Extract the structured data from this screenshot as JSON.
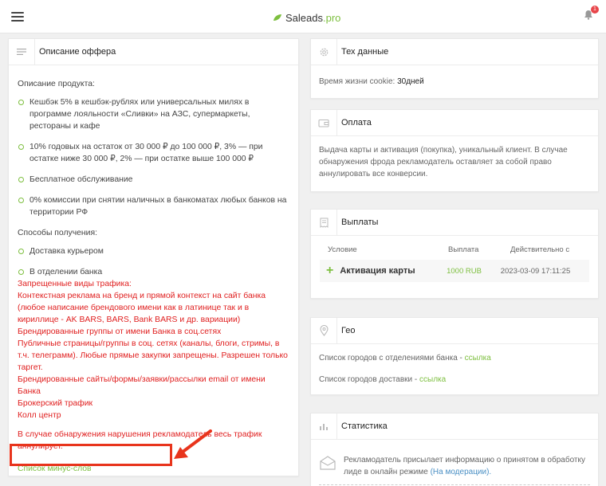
{
  "header": {
    "logo_main": "Saleads",
    "logo_suffix": ".pro",
    "notification_count": "1"
  },
  "offer": {
    "title": "Описание оффера",
    "product_heading": "Описание продукта:",
    "product_items": [
      "Кешбэк 5% в кешбэк-рублях или универсальных милях в программе лояльности «Сливки» на АЗС, супермаркеты, рестораны и кафе",
      "10% годовых на остаток от 30 000 ₽ до 100 000 ₽, 3% — при остатке ниже 30 000 ₽, 2% — при остатке выше 100 000 ₽",
      "Бесплатное обслуживание",
      "0% комиссии при снятии наличных в банкоматах любых банков на территории РФ"
    ],
    "receive_heading": "Способы получения:",
    "receive_items": [
      "Доставка курьером",
      "В отделении банка"
    ],
    "forbidden_lines": [
      "Запрещенные виды трафика:",
      "Контекстная реклама на бренд и прямой контекст на сайт банка (любое написание брендового имени как в латинице так и в кириллице - AK BARS, BARS, Bank BARS и др. вариации)",
      "Брендированные группы от имени Банка в соц.сетях",
      "Публичные страницы/группы в соц. сетях (каналы, блоги, стримы, в т.ч. телеграмм). Любые прямые закупки запрещены. Разрешен только таргет.",
      "Брендированные сайты/формы/заявки/рассылки email от имени Банка",
      "Брокерский трафик",
      "Колл центр"
    ],
    "violation_text": "В случае обнаружения нарушения рекламодатель весь трафик аннулирует.",
    "minus_words_link": "Список минус-слов"
  },
  "tech": {
    "title": "Тех данные",
    "cookie_label": "Время жизни cookie:",
    "cookie_value": "30дней"
  },
  "payment": {
    "title": "Оплата",
    "text": "Выдача карты и активация (покупка), уникальный клиент. В случае обнаружения фрода рекламодатель оставляет за собой право аннулировать все конверсии."
  },
  "payouts": {
    "title": "Выплаты",
    "columns": [
      "Условие",
      "Выплата",
      "Действительно с"
    ],
    "rows": [
      {
        "plus": "+",
        "condition": "Активация карты",
        "payout": "1000 RUB",
        "valid_from": "2023-03-09 17:11:25"
      }
    ]
  },
  "geo": {
    "title": "Гео",
    "line1_text": "Список городов с отделениями банка -",
    "line1_link": "ссылка",
    "line2_text": "Список городов доставки -",
    "line2_link": "ссылка"
  },
  "stats": {
    "title": "Статистика",
    "text": "Рекламодатель присылает информацию о принятом в обработку лиде в онлайн режиме",
    "link": "(На модерации)."
  },
  "colors": {
    "accent_green": "#7dbf3f",
    "forbidden_red": "#e02020",
    "annotation_red": "#e8341c"
  }
}
